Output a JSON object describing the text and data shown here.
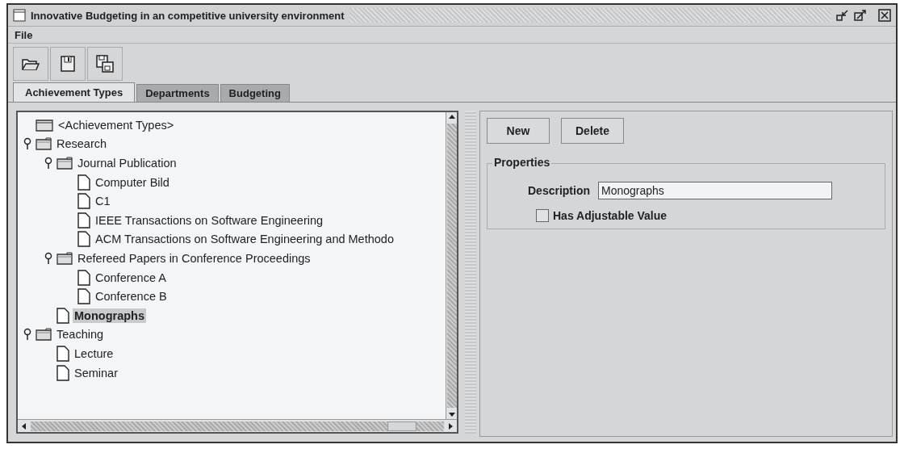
{
  "window": {
    "title": "Innovative Budgeting in an competitive university environment"
  },
  "menu": [
    "File"
  ],
  "tabs": [
    {
      "label": "Achievement Types",
      "selected": true
    },
    {
      "label": "Departments",
      "selected": false
    },
    {
      "label": "Budgeting",
      "selected": false
    }
  ],
  "tree": [
    {
      "label": "<Achievement Types>",
      "kind": "root",
      "selected": false,
      "children": [
        {
          "label": "Research",
          "kind": "folder",
          "selected": false,
          "expanded": true,
          "children": [
            {
              "label": "Journal Publication",
              "kind": "folder",
              "selected": false,
              "expanded": true,
              "children": [
                {
                  "label": "Computer Bild",
                  "kind": "leaf",
                  "selected": false
                },
                {
                  "label": "C1",
                  "kind": "leaf",
                  "selected": false
                },
                {
                  "label": "IEEE Transactions on Software Engineering",
                  "kind": "leaf",
                  "selected": false
                },
                {
                  "label": "ACM Transactions on Software Engineering and Methodo",
                  "kind": "leaf",
                  "selected": false
                }
              ]
            },
            {
              "label": "Refereed Papers in Conference Proceedings",
              "kind": "folder",
              "selected": false,
              "expanded": true,
              "children": [
                {
                  "label": "Conference A",
                  "kind": "leaf",
                  "selected": false
                },
                {
                  "label": "Conference B",
                  "kind": "leaf",
                  "selected": false
                }
              ]
            },
            {
              "label": "Monographs",
              "kind": "leaf",
              "selected": true
            }
          ]
        },
        {
          "label": "Teaching",
          "kind": "folder",
          "selected": false,
          "expanded": true,
          "children": [
            {
              "label": "Lecture",
              "kind": "leaf",
              "selected": false
            },
            {
              "label": "Seminar",
              "kind": "leaf",
              "selected": false
            }
          ]
        }
      ]
    }
  ],
  "buttons": [
    "New",
    "Delete"
  ],
  "properties": {
    "title": "Properties",
    "description_label": "Description",
    "description_value": "Monographs",
    "checkbox": {
      "label": "Has Adjustable Value",
      "checked": false
    }
  }
}
